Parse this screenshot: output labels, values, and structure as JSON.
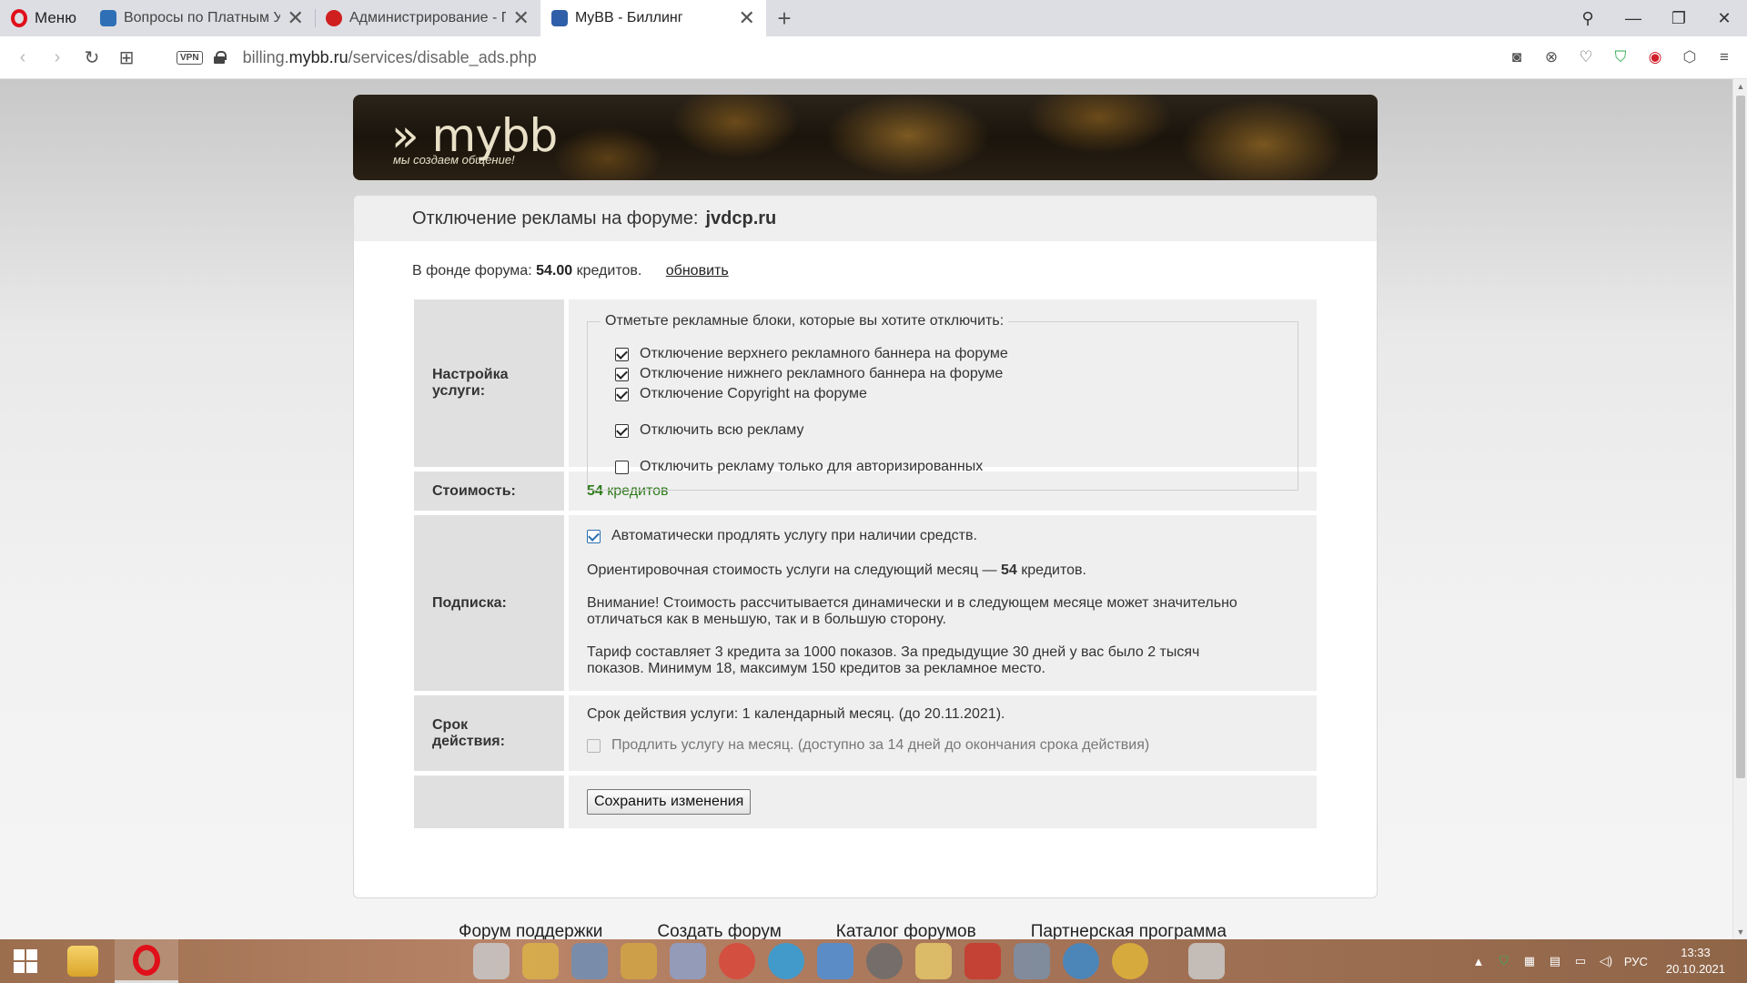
{
  "browser": {
    "menu_label": "Меню",
    "tabs": [
      {
        "title": "Вопросы по Платным Усл",
        "favicon_color": "#2f6fb5",
        "active": false
      },
      {
        "title": "Администрирование - Пл",
        "favicon_color": "#d01f1f",
        "active": false
      },
      {
        "title": "MyBB - Биллинг",
        "favicon_color": "#2f5fa8",
        "active": true
      }
    ],
    "new_tab": "+",
    "url_prefix": "billing.",
    "url_domain": "mybb.ru",
    "url_path": "/services/disable_ads.php",
    "vpn_label": "VPN"
  },
  "banner": {
    "logo": "» mybb",
    "tagline": "мы   создаем   общение!"
  },
  "page": {
    "title_prefix": "Отключение рекламы на форуме:",
    "forum_name": "jvdcp.ru",
    "fund_prefix": "В фонде форума:",
    "fund_amount": "54.00",
    "fund_suffix": "кредитов.",
    "refresh_link": "обновить",
    "rows": {
      "settings": {
        "label_line1": "Настройка",
        "label_line2": "услуги:",
        "legend": "Отметьте рекламные блоки, которые вы хотите отключить:",
        "options": [
          {
            "label": "Отключение верхнего рекламного баннера на форуме",
            "checked": true
          },
          {
            "label": "Отключение нижнего рекламного баннера на форуме",
            "checked": true
          },
          {
            "label": "Отключение Copyright на форуме",
            "checked": true
          }
        ],
        "disable_all": {
          "label": "Отключить всю рекламу",
          "checked": true
        },
        "auth_only": {
          "label": "Отключить рекламу только для авторизированных",
          "checked": false
        }
      },
      "cost": {
        "label": "Стоимость:",
        "amount": "54",
        "unit": "кредитов"
      },
      "subscription": {
        "label": "Подписка:",
        "auto_renew": {
          "label": "Автоматически продлять услугу при наличии средств.",
          "checked": true
        },
        "estimate_prefix": "Ориентировочная стоимость услуги на следующий месяц —",
        "estimate_amount": "54",
        "estimate_suffix": "кредитов.",
        "warning_line1": "Внимание! Стоимость рассчитывается динамически и в следующем месяце может значительно",
        "warning_line2": "отличаться как в меньшую, так и в большую сторону.",
        "tariff_line1": "Тариф составляет 3 кредита за 1000 показов. За предыдущие 30 дней у вас было 2 тысяч",
        "tariff_line2": "показов. Минимум 18, максимум 150 кредитов за рекламное место."
      },
      "term": {
        "label_line1": "Срок",
        "label_line2": "действия:",
        "text": "Срок действия услуги: 1 календарный месяц. (до 20.11.2021).",
        "extend": {
          "label": "Продлить услугу на месяц. (доступно за 14 дней до окончания срока действия)",
          "checked": false
        }
      },
      "save_label": "Сохранить изменения"
    },
    "footer_links": [
      "Форум поддержки",
      "Создать форум",
      "Каталог форумов",
      "Партнерская программа"
    ]
  },
  "taskbar": {
    "language": "РУС",
    "time": "13:33",
    "date": "20.10.2021"
  }
}
